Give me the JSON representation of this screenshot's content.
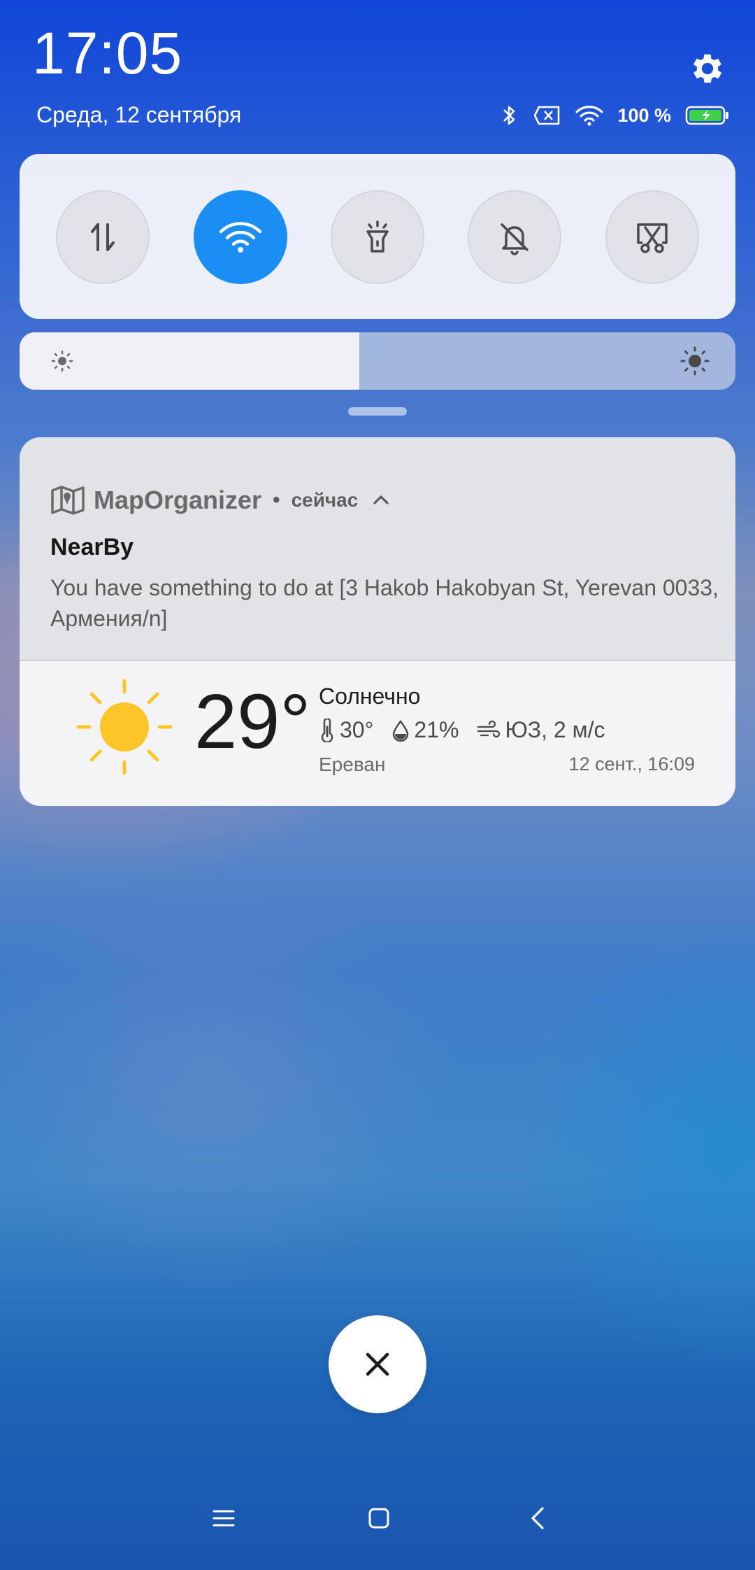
{
  "header": {
    "time": "17:05",
    "date": "Среда, 12 сентября",
    "battery": "100 %"
  },
  "icons": {
    "settings": "gear-icon",
    "bluetooth": "bluetooth-icon",
    "no_sim": "no-sim-icon",
    "wifi": "wifi-icon",
    "battery": "battery-charging-icon"
  },
  "quick_settings": [
    {
      "name": "mobile-data",
      "icon": "data-arrows-icon",
      "active": false
    },
    {
      "name": "wifi",
      "icon": "wifi-icon",
      "active": true
    },
    {
      "name": "flashlight",
      "icon": "flashlight-icon",
      "active": false
    },
    {
      "name": "silent",
      "icon": "bell-off-icon",
      "active": false
    },
    {
      "name": "screenshot",
      "icon": "scissors-icon",
      "active": false
    }
  ],
  "brightness": {
    "level": 0.475
  },
  "notification": {
    "app_name": "MapOrganizer",
    "separator": "•",
    "time": "сейчас",
    "title": "NearBy",
    "text": "You have something to do at [3 Hakob Hakobyan St, Yerevan 0033, Армения/n]"
  },
  "weather": {
    "temperature": "29°",
    "condition": "Солнечно",
    "feels_like": "30°",
    "humidity": "21%",
    "wind": "ЮЗ, 2 м/с",
    "city": "Ереван",
    "updated": "12 сент., 16:09"
  },
  "colors": {
    "accent": "#1a8ef5",
    "sun": "#fcc629"
  }
}
